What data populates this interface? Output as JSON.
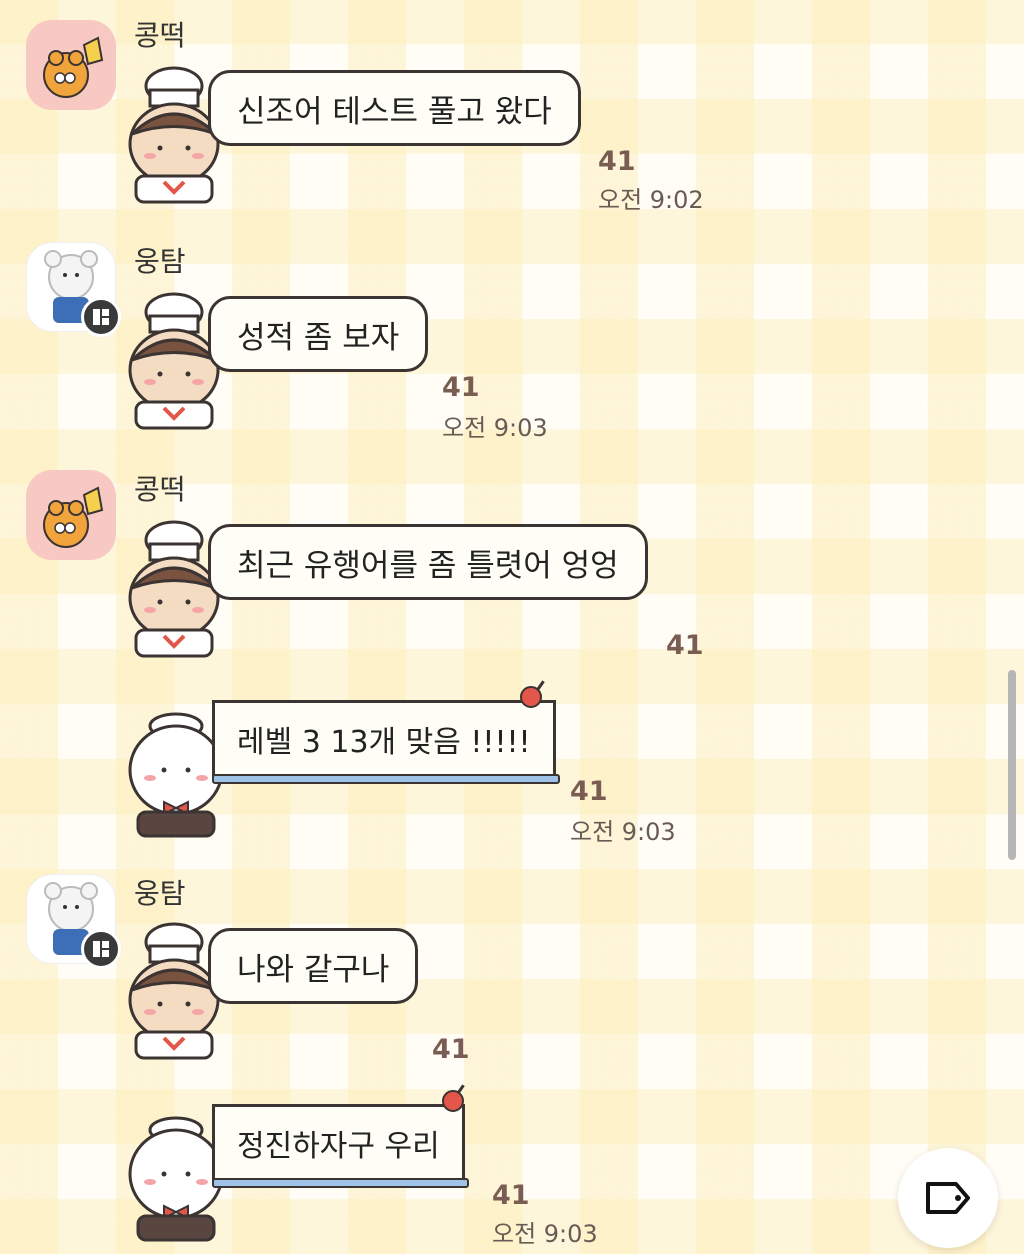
{
  "messages": [
    {
      "sender": "콩떡",
      "text": "신조어 테스트 풀고 왔다",
      "read": "41",
      "time": "오전 9:02"
    },
    {
      "sender": "웅탐",
      "text": "성적 좀 보자",
      "read": "41",
      "time": "오전 9:03"
    },
    {
      "sender": "콩떡",
      "text": "최근 유행어를 좀 틀렷어 엉엉",
      "read": "41"
    },
    {
      "text": "레벨 3 13개 맞음 !!!!!",
      "read": "41",
      "time": "오전 9:03"
    },
    {
      "sender": "웅탐",
      "text": "나와 같구나",
      "read": "41"
    },
    {
      "text": "정진하자구 우리",
      "read": "41",
      "time": "오전 9:03"
    }
  ],
  "icons": {
    "chef_sticker": "chef-character-icon",
    "waiter_sticker": "waiter-character-icon",
    "fab": "tag-icon",
    "badge": "app-badge-icon"
  },
  "colors": {
    "bubble_border": "#3b3432",
    "read_count": "#7a5d52",
    "timestamp": "#6a5a54"
  }
}
